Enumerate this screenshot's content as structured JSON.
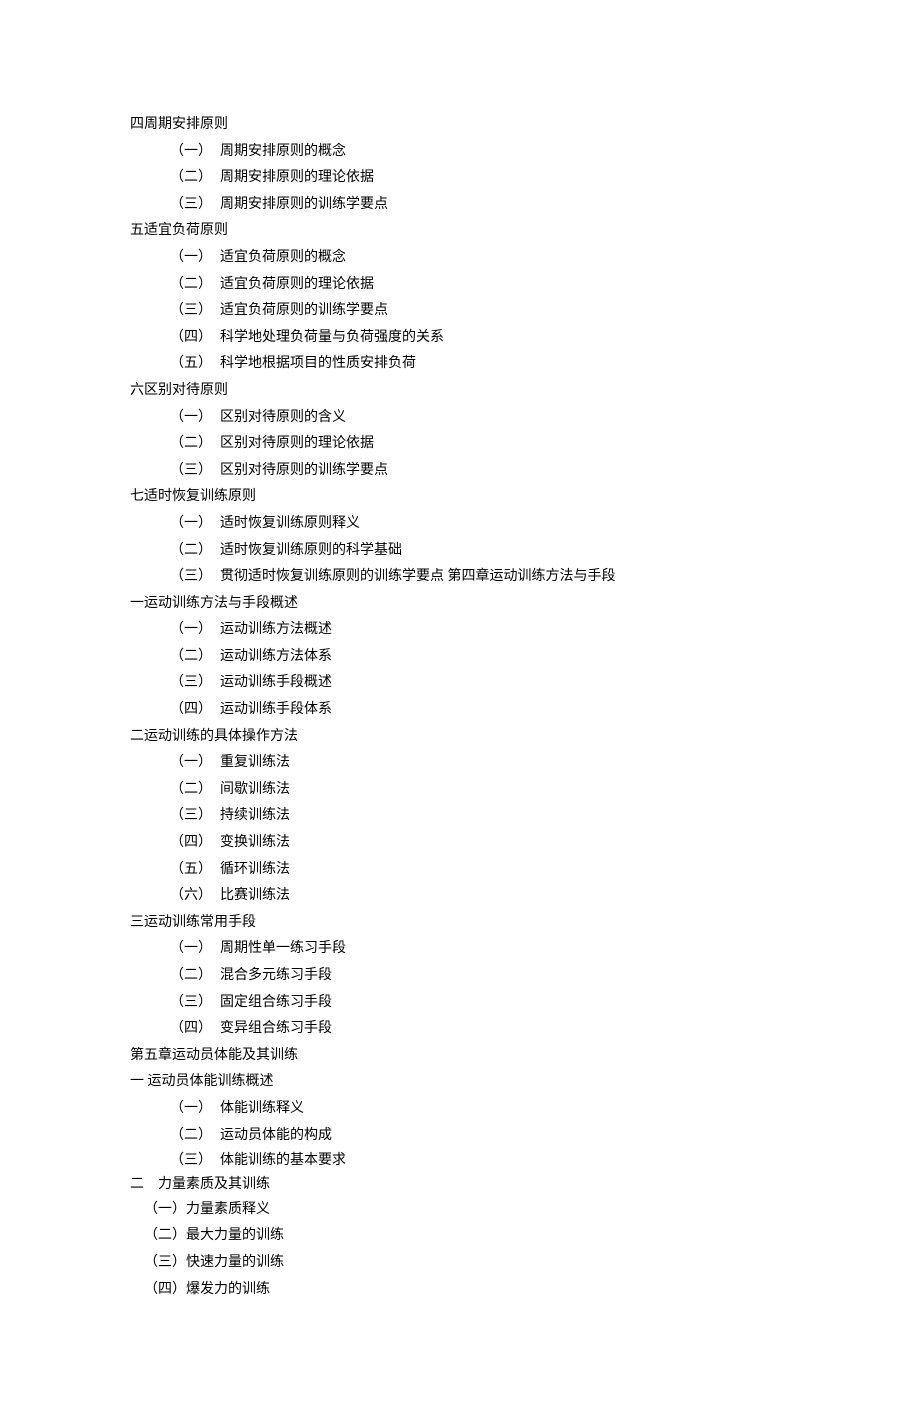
{
  "s4": {
    "title": "四周期安排原则",
    "items": [
      {
        "n": "（一）",
        "t": "周期安排原则的概念"
      },
      {
        "n": "（二）",
        "t": "周期安排原则的理论依据"
      },
      {
        "n": "（三）",
        "t": "周期安排原则的训练学要点"
      }
    ]
  },
  "s5": {
    "title": "五适宜负荷原则",
    "items": [
      {
        "n": "（一）",
        "t": "适宜负荷原则的概念"
      },
      {
        "n": "（二）",
        "t": "适宜负荷原则的理论依据"
      },
      {
        "n": "（三）",
        "t": "适宜负荷原则的训练学要点"
      },
      {
        "n": "（四）",
        "t": "科学地处理负荷量与负荷强度的关系"
      },
      {
        "n": "（五）",
        "t": "科学地根据项目的性质安排负荷"
      }
    ]
  },
  "s6": {
    "title": "六区别对待原则",
    "items": [
      {
        "n": "（一）",
        "t": "区别对待原则的含义"
      },
      {
        "n": "（二）",
        "t": "区别对待原则的理论依据"
      },
      {
        "n": "（三）",
        "t": "区别对待原则的训练学要点"
      }
    ]
  },
  "s7": {
    "title": "七适时恢复训练原则",
    "items": [
      {
        "n": "（一）",
        "t": "适时恢复训练原则释义"
      },
      {
        "n": "（二）",
        "t": "适时恢复训练原则的科学基础"
      },
      {
        "n": "（三）",
        "t": "贯彻适时恢复训练原则的训练学要点  第四章运动训练方法与手段"
      }
    ]
  },
  "c4_1": {
    "title": "一运动训练方法与手段概述",
    "items": [
      {
        "n": "（一）",
        "t": "运动训练方法概述"
      },
      {
        "n": "（二）",
        "t": "运动训练方法体系"
      },
      {
        "n": "（三）",
        "t": "运动训练手段概述"
      },
      {
        "n": "（四）",
        "t": "运动训练手段体系"
      }
    ]
  },
  "c4_2": {
    "title": "二运动训练的具体操作方法",
    "items": [
      {
        "n": "（一）",
        "t": "重复训练法"
      },
      {
        "n": "（二）",
        "t": "间歇训练法"
      },
      {
        "n": "（三）",
        "t": "持续训练法"
      },
      {
        "n": "（四）",
        "t": "变换训练法"
      },
      {
        "n": "（五）",
        "t": "循环训练法"
      },
      {
        "n": "（六）",
        "t": "比赛训练法"
      }
    ]
  },
  "c4_3": {
    "title": "三运动训练常用手段",
    "items": [
      {
        "n": "（一）",
        "t": "周期性单一练习手段"
      },
      {
        "n": "（二）",
        "t": "混合多元练习手段"
      },
      {
        "n": "（三）",
        "t": "固定组合练习手段"
      },
      {
        "n": "（四）",
        "t": "变异组合练习手段"
      }
    ]
  },
  "c5_title": "第五章运动员体能及其训练",
  "c5_1": {
    "title": "一  运动员体能训练概述",
    "items": [
      {
        "n": "（一）",
        "t": "体能训练释义"
      },
      {
        "n": "（二）",
        "t": "运动员体能的构成"
      },
      {
        "n": "（三）",
        "t": "体能训练的基本要求"
      }
    ]
  },
  "c5_2": {
    "title": "二　力量素质及其训练",
    "items": [
      "（一）力量素质释义",
      "（二）最大力量的训练",
      "（三）快速力量的训练",
      "（四）爆发力的训练"
    ]
  }
}
